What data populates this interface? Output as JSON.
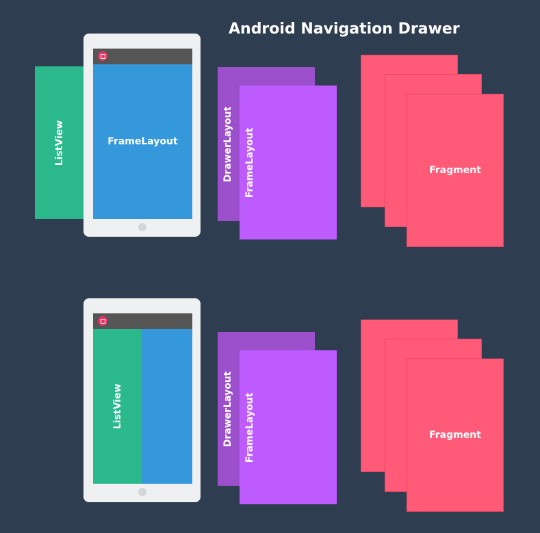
{
  "title": "Android Navigation Drawer",
  "diagrams": [
    {
      "list_view_label": "ListView",
      "frame_layout_label": "FrameLayout",
      "drawer_layout_label": "DrawerLayout",
      "drawer_frame_label": "FrameLayout",
      "fragment_label": "Fragment"
    },
    {
      "list_view_label": "ListView",
      "drawer_layout_label": "DrawerLayout",
      "drawer_frame_label": "FrameLayout",
      "fragment_label": "Fragment"
    }
  ],
  "colors": {
    "background": "#2e3d4f",
    "list_view": "#2bb88a",
    "frame_layout": "#3498db",
    "drawer_layout": "#9b4fcb",
    "drawer_frame_layout": "#be5bff",
    "fragment": "#ff5a78",
    "tablet_body": "#eef0f1",
    "status_bar": "#555555"
  },
  "icons": {
    "app_icon": "app-launcher-icon",
    "home_button": "home-button-icon"
  }
}
